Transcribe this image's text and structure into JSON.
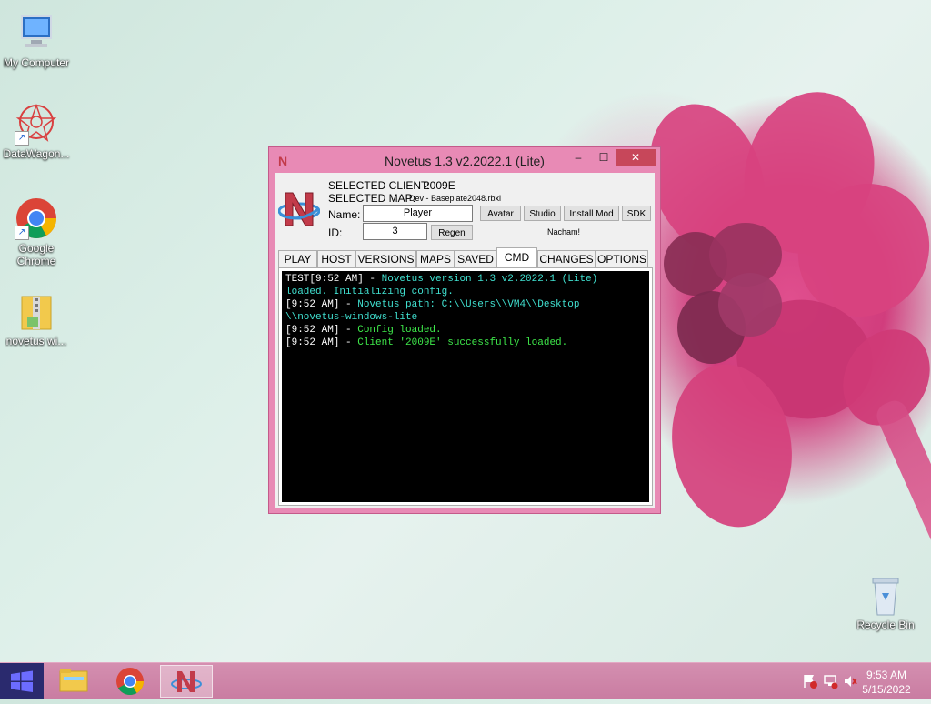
{
  "desktop": {
    "icons": [
      {
        "label": "My Computer"
      },
      {
        "label": "DataWagon..."
      },
      {
        "label": "Google Chrome"
      },
      {
        "label": "novetus wi..."
      },
      {
        "label": "Recycle Bin"
      }
    ]
  },
  "window": {
    "title": "Novetus 1.3 v2.2022.1 (Lite)",
    "minimize_glyph": "–",
    "maximize_glyph": "☐",
    "close_glyph": "✕",
    "icon_letter": "N",
    "selected_client_label": "SELECTED CLIENT:",
    "selected_client_value": "2009E",
    "selected_map_label": "SELECTED MAP:",
    "selected_map_value": "Dev - Baseplate2048.rbxl",
    "name_label": "Name:",
    "name_value": "Player",
    "id_label": "ID:",
    "id_value": "3",
    "buttons": {
      "avatar": "Avatar",
      "studio": "Studio",
      "install_mod": "Install Mod",
      "sdk": "SDK",
      "regen": "Regen"
    },
    "splash": "Nacham!",
    "tabs": [
      "PLAY",
      "HOST",
      "VERSIONS",
      "MAPS",
      "SAVED",
      "CMD",
      "CHANGES",
      "OPTIONS"
    ],
    "active_tab": "CMD",
    "console_lines": [
      {
        "prefix": "TEST[9:52 AM] - ",
        "text": "Novetus version 1.3 v2.2022.1 (Lite)",
        "color": "#40e0d0"
      },
      {
        "prefix": "",
        "text": "loaded. Initializing config.",
        "color": "#40e0d0"
      },
      {
        "prefix": "[9:52 AM] - ",
        "text": "Novetus path: C:\\\\Users\\\\VM4\\\\Desktop",
        "color": "#40e0d0"
      },
      {
        "prefix": "",
        "text": "\\\\novetus-windows-lite",
        "color": "#40e0d0"
      },
      {
        "prefix": "[9:52 AM] - ",
        "text": "Config loaded.",
        "color": "#3ee84a"
      },
      {
        "prefix": "[9:52 AM] - ",
        "text": "Client '2009E' successfully loaded.",
        "color": "#3ee84a"
      }
    ]
  },
  "taskbar": {
    "time": "9:53 AM",
    "date": "5/15/2022"
  },
  "colors": {
    "window_frame": "#e88ab5",
    "close_button": "#c7475a",
    "console_bg": "#000000"
  }
}
